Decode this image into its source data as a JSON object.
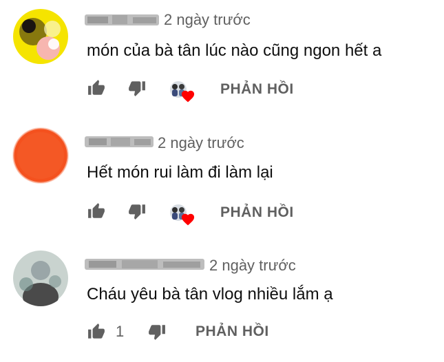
{
  "comments": [
    {
      "timestamp": "2 ngày trước",
      "text": "món của bà tân lúc nào cũng ngon hết a",
      "reply_label": "PHẢN HỒI",
      "creator_hearted": true,
      "avatar_colors": [
        "#f5e400",
        "#f7b6b0",
        "#2b1f1a",
        "#ffffff"
      ]
    },
    {
      "timestamp": "2 ngày trước",
      "text": "Hết món rui làm đi làm lại",
      "reply_label": "PHẢN HỒI",
      "creator_hearted": true,
      "avatar_colors": [
        "#f4511e",
        "#ffffff"
      ]
    },
    {
      "timestamp": "2 ngày trước",
      "text": "Cháu yêu bà tân vlog nhiều lắm ạ",
      "like_count": "1",
      "reply_label": "PHẢN HỒI",
      "creator_hearted": false,
      "avatar_colors": [
        "#9aa6a8",
        "#4a4a4a",
        "#c9d3cf"
      ]
    }
  ],
  "icons": {
    "like": "thumbs-up-icon",
    "dislike": "thumbs-down-icon",
    "heart": "creator-heart-icon"
  },
  "colors": {
    "icon_gray": "#606060",
    "heart_red": "#ff0000"
  }
}
